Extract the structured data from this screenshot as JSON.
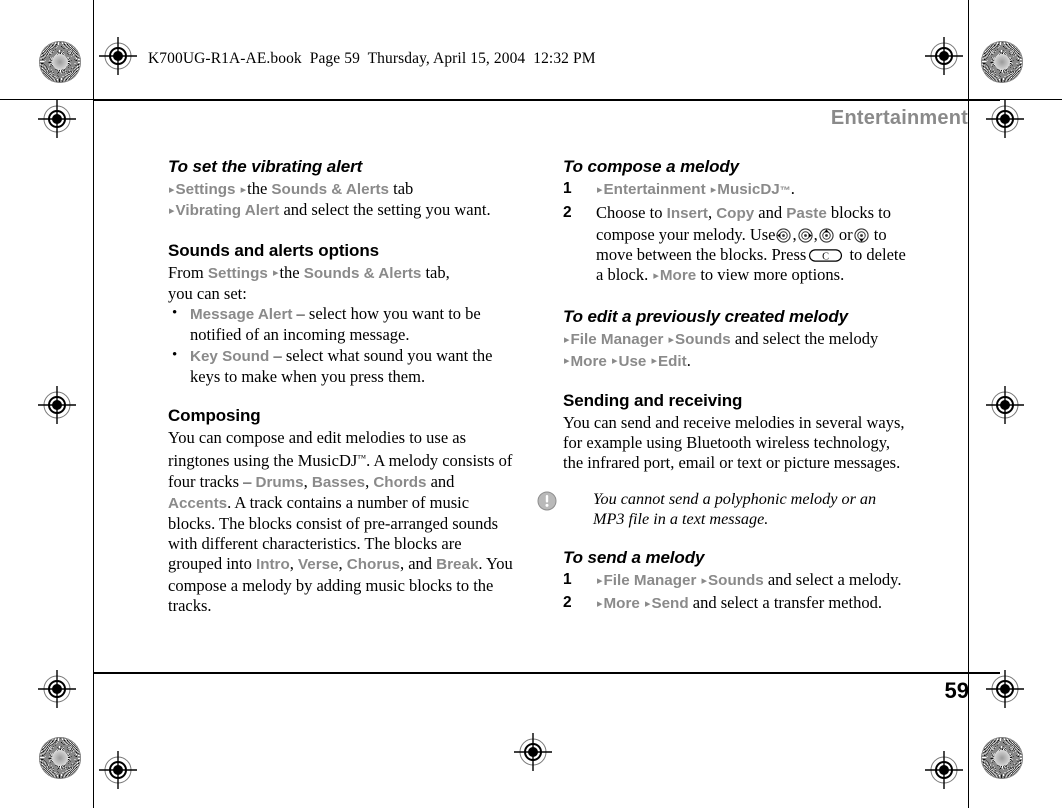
{
  "slug": {
    "text": "K700UG-R1A-AE.book  Page 59  Thursday, April 15, 2004  12:32 PM"
  },
  "running_head": {
    "title": "Entertainment"
  },
  "folio": {
    "page_number": "59"
  },
  "colors": {
    "ui_term_gray": "#8a8a8a",
    "body_text": "#000000",
    "note_icon_gray": "#9b9b9b"
  },
  "left_column": {
    "proc1": {
      "heading": "To set the vibrating alert",
      "line1": {
        "a1": "▸",
        "t1": "Settings",
        "a2": "▸",
        "t2": "the",
        "t3": "Sounds & Alerts",
        "t4": "tab"
      },
      "line2": {
        "a1": "▸",
        "t1": "Vibrating Alert",
        "t2": "and select the setting you want."
      }
    },
    "sect1": {
      "heading": "Sounds and alerts options",
      "intro_a": "From",
      "intro_term1": "Settings",
      "intro_arrow": "▸",
      "intro_b": "the",
      "intro_term2": "Sounds & Alerts",
      "intro_c": "tab,",
      "intro_d": "you can set:",
      "bullets": [
        {
          "term": "Message Alert",
          "dash": "–",
          "text": "select how you want to be notified of an incoming message."
        },
        {
          "term": "Key Sound",
          "dash": "–",
          "text": "select what sound you want the keys to make when you press them."
        }
      ]
    },
    "sect2": {
      "heading": "Composing",
      "p1_a": "You can compose and edit melodies to use as ringtones using the MusicDJ",
      "p1_tm": "™",
      "p1_b": ". A melody consists of four tracks",
      "p1_dash": "–",
      "tracks": [
        "Drums",
        "Basses",
        "Chords",
        "Accents"
      ],
      "p1_and": "and",
      "p1_c": ". A track contains a number of music blocks. The blocks consist of pre-arranged sounds with different characteristics. The blocks are grouped into",
      "groups": [
        "Intro",
        "Verse",
        "Chorus",
        "Break"
      ],
      "p1_and2": "and",
      "p1_d": ". You compose a melody by adding music blocks to the tracks."
    }
  },
  "right_column": {
    "proc1": {
      "heading": "To compose a melody",
      "steps": [
        {
          "num": "1",
          "a1": "▸",
          "t1": "Entertainment",
          "a2": "▸",
          "t2": "MusicDJ",
          "tm": "™",
          "end": "."
        },
        {
          "num": "2",
          "pre": "Choose to",
          "term1": "Insert",
          "sep1": ",",
          "term2": "Copy",
          "mid": "and",
          "term3": "Paste",
          "post": "blocks to compose your melody. Use",
          "keys": [
            "nav-left-key",
            "nav-right-key",
            "nav-up-key",
            "nav-down-key"
          ],
          "or_word": "or",
          "after_keys": "to move between the blocks. Press",
          "clear_key_label": "C",
          "after_key2": "to delete a block.",
          "arrow_more": "▸",
          "term_more": "More",
          "tail": "to view more options."
        }
      ]
    },
    "proc2": {
      "heading": "To edit a previously created melody",
      "line1": {
        "a1": "▸",
        "t1": "File Manager",
        "a2": "▸",
        "t2": "Sounds",
        "t3": "and select the melody"
      },
      "line2": {
        "a1": "▸",
        "t1": "More",
        "a2": "▸",
        "t2": "Use",
        "a3": "▸",
        "t3": "Edit",
        "end": "."
      }
    },
    "sect1": {
      "heading": "Sending and receiving",
      "paragraph": "You can send and receive melodies in several ways, for example using Bluetooth wireless technology, the infrared port, email or text or picture messages."
    },
    "note": {
      "icon": "exclamation-circle-icon",
      "text": "You cannot send a polyphonic melody or an MP3 file in a text message."
    },
    "proc3": {
      "heading": "To send a melody",
      "steps": [
        {
          "num": "1",
          "a1": "▸",
          "t1": "File Manager",
          "a2": "▸",
          "t2": "Sounds",
          "t3": "and select a melody."
        },
        {
          "num": "2",
          "a1": "▸",
          "t1": "More",
          "a2": "▸",
          "t2": "Send",
          "t3": "and select a transfer method."
        }
      ]
    }
  }
}
